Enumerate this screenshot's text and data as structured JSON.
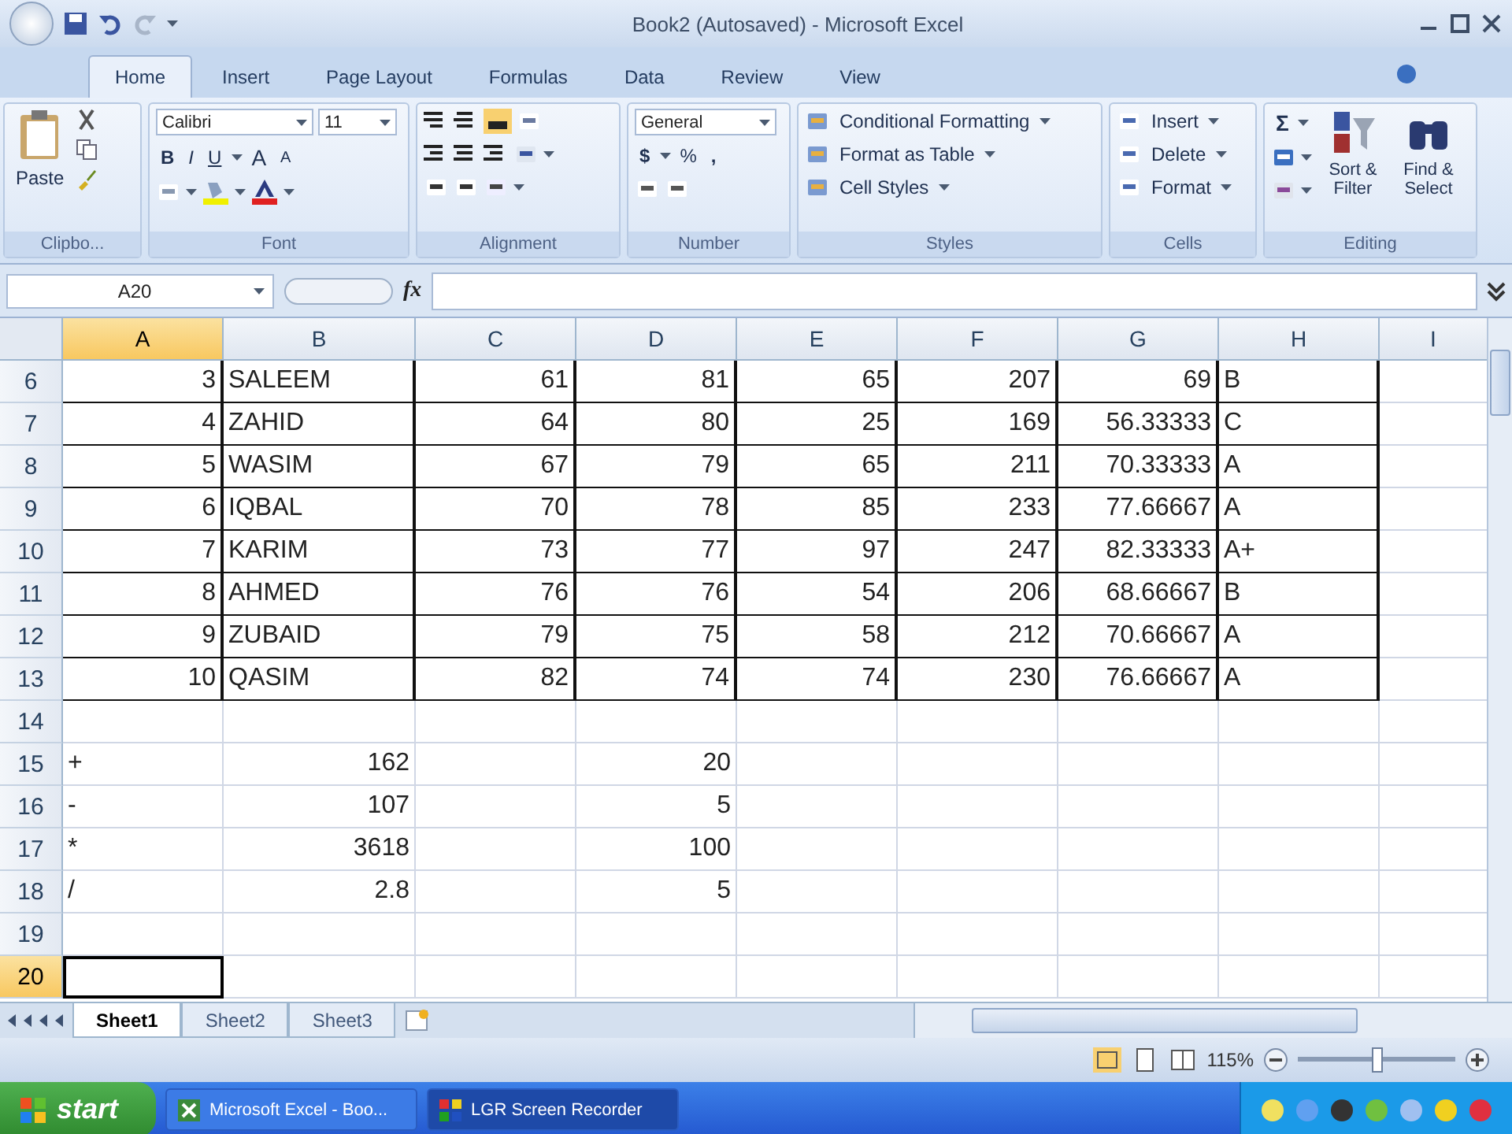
{
  "window": {
    "title": "Book2 (Autosaved) - Microsoft Excel"
  },
  "tabs": [
    {
      "label": "Home",
      "selected": true
    },
    {
      "label": "Insert",
      "selected": false
    },
    {
      "label": "Page Layout",
      "selected": false
    },
    {
      "label": "Formulas",
      "selected": false
    },
    {
      "label": "Data",
      "selected": false
    },
    {
      "label": "Review",
      "selected": false
    },
    {
      "label": "View",
      "selected": false
    }
  ],
  "ribbon": {
    "clipboard": {
      "label": "Clipbo...",
      "paste": "Paste"
    },
    "font": {
      "label": "Font",
      "font_name": "Calibri",
      "font_size": "11",
      "bold": "B",
      "italic": "I",
      "underline": "U",
      "grow": "A",
      "shrink": "A"
    },
    "alignment": {
      "label": "Alignment"
    },
    "number": {
      "label": "Number",
      "format": "General",
      "currency": "$",
      "percent": "%",
      "comma": ","
    },
    "styles": {
      "label": "Styles",
      "items": [
        "Conditional Formatting",
        "Format as Table",
        "Cell Styles"
      ]
    },
    "cells": {
      "label": "Cells",
      "items": [
        "Insert",
        "Delete",
        "Format"
      ]
    },
    "editing": {
      "label": "Editing",
      "sum": "Σ",
      "sort": "Sort & Filter",
      "find": "Find & Select"
    }
  },
  "formula_bar": {
    "name_box": "A20",
    "function_label": "fx"
  },
  "columns": [
    {
      "label": "A",
      "selected": true
    },
    {
      "label": "B",
      "selected": false
    },
    {
      "label": "C",
      "selected": false
    },
    {
      "label": "D",
      "selected": false
    },
    {
      "label": "E",
      "selected": false
    },
    {
      "label": "F",
      "selected": false
    },
    {
      "label": "G",
      "selected": false
    },
    {
      "label": "H",
      "selected": false
    },
    {
      "label": "I",
      "selected": false
    }
  ],
  "rows": [
    {
      "number": "6",
      "kind": "record",
      "selected": false,
      "cells": [
        "3",
        "SALEEM",
        "61",
        "81",
        "65",
        "207",
        "69",
        "B"
      ]
    },
    {
      "number": "7",
      "kind": "record",
      "selected": false,
      "cells": [
        "4",
        "ZAHID",
        "64",
        "80",
        "25",
        "169",
        "56.33333",
        "C"
      ]
    },
    {
      "number": "8",
      "kind": "record",
      "selected": false,
      "cells": [
        "5",
        "WASIM",
        "67",
        "79",
        "65",
        "211",
        "70.33333",
        "A"
      ]
    },
    {
      "number": "9",
      "kind": "record",
      "selected": false,
      "cells": [
        "6",
        "IQBAL",
        "70",
        "78",
        "85",
        "233",
        "77.66667",
        "A"
      ]
    },
    {
      "number": "10",
      "kind": "record",
      "selected": false,
      "cells": [
        "7",
        "KARIM",
        "73",
        "77",
        "97",
        "247",
        "82.33333",
        "A+"
      ]
    },
    {
      "number": "11",
      "kind": "record",
      "selected": false,
      "cells": [
        "8",
        "AHMED",
        "76",
        "76",
        "54",
        "206",
        "68.66667",
        "B"
      ]
    },
    {
      "number": "12",
      "kind": "record",
      "selected": false,
      "cells": [
        "9",
        "ZUBAID",
        "79",
        "75",
        "58",
        "212",
        "70.66667",
        "A"
      ]
    },
    {
      "number": "13",
      "kind": "record",
      "selected": false,
      "cells": [
        "10",
        "QASIM",
        "82",
        "74",
        "74",
        "230",
        "76.66667",
        "A"
      ]
    },
    {
      "number": "14",
      "kind": "blank",
      "selected": false
    },
    {
      "number": "15",
      "kind": "calc",
      "selected": false,
      "cells": [
        "+",
        "162",
        "",
        "20"
      ]
    },
    {
      "number": "16",
      "kind": "calc",
      "selected": false,
      "cells": [
        "-",
        "107",
        "",
        "5"
      ]
    },
    {
      "number": "17",
      "kind": "calc",
      "selected": false,
      "cells": [
        "*",
        "3618",
        "",
        "100"
      ]
    },
    {
      "number": "18",
      "kind": "calc",
      "selected": false,
      "cells": [
        "/",
        "2.8",
        "",
        "5"
      ]
    },
    {
      "number": "19",
      "kind": "blank",
      "selected": false
    },
    {
      "number": "20",
      "kind": "blank",
      "selected": true
    }
  ],
  "sheet_tabs": [
    {
      "label": "Sheet1",
      "selected": true
    },
    {
      "label": "Sheet2",
      "selected": false
    },
    {
      "label": "Sheet3",
      "selected": false
    }
  ],
  "status_bar": {
    "zoom": "115%",
    "zoom_slider": {
      "level": 0.5
    }
  },
  "taskbar": {
    "start": "start",
    "buttons": [
      {
        "label": "Microsoft Excel - Boo...",
        "selected": false
      },
      {
        "label": "LGR Screen Recorder",
        "selected": true
      }
    ]
  }
}
